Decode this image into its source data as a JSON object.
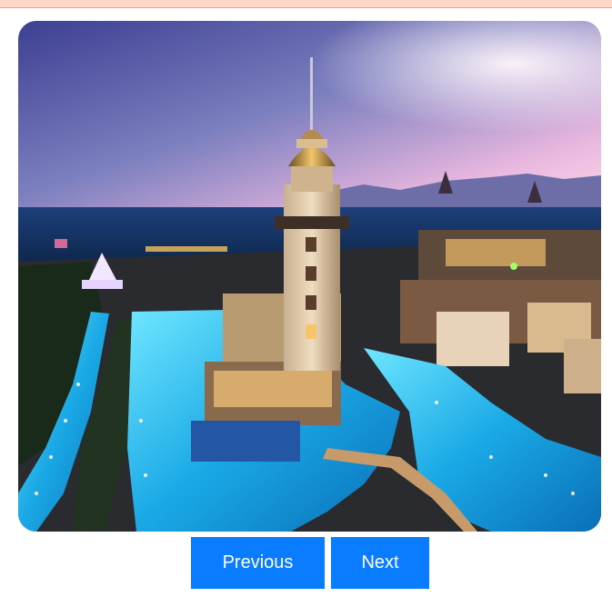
{
  "carousel": {
    "image_subject": "resort-photo",
    "buttons": {
      "previous_label": "Previous",
      "next_label": "Next"
    }
  },
  "colors": {
    "button_bg": "#0a7cff",
    "button_text": "#ffffff",
    "top_strip": "#ffd8c8"
  }
}
